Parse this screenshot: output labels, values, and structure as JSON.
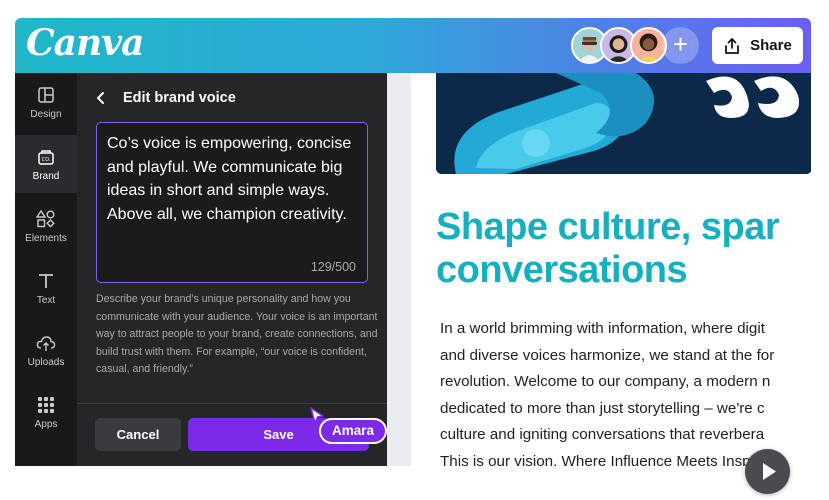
{
  "app": {
    "logo": "Canva"
  },
  "topbar": {
    "share_label": "Share",
    "add_label": "+"
  },
  "rail": {
    "items": [
      {
        "label": "Design",
        "icon": "layout-icon"
      },
      {
        "label": "Brand",
        "icon": "brand-kit-icon"
      },
      {
        "label": "Elements",
        "icon": "shapes-icon"
      },
      {
        "label": "Text",
        "icon": "text-icon"
      },
      {
        "label": "Uploads",
        "icon": "cloud-upload-icon"
      },
      {
        "label": "Apps",
        "icon": "grid-icon"
      }
    ],
    "active": "Brand"
  },
  "panel": {
    "title": "Edit brand voice",
    "voice_text": "Co’s voice is empowering, concise and playful. We communicate big ideas in short and simple ways. Above all, we champion creativity.",
    "counter": "129/500",
    "help_text": "Describe your brand’s unique personality and how you communicate with your audience. Your voice is an important way to attract people to your brand, create connections, and build trust with them. For example, “our voice is confident, casual, and friendly.”",
    "cancel_label": "Cancel",
    "save_label": "Save"
  },
  "collaborator": {
    "name": "Amara"
  },
  "document": {
    "headline_line1": "Shape culture, spar",
    "headline_line2": "conversations",
    "body_lines": [
      "In a world brimming with information, where digit",
      "and diverse voices harmonize, we stand at the for",
      "revolution. Welcome to our company, a modern n",
      "dedicated to more than just storytelling – we're c",
      "culture and igniting conversations that reverbera",
      "This is our vision. Where Influence Meets Inspirat"
    ]
  },
  "colors": {
    "accent": "#7d2ae8",
    "headline": "#14b0c0",
    "panel_bg": "#252627"
  }
}
